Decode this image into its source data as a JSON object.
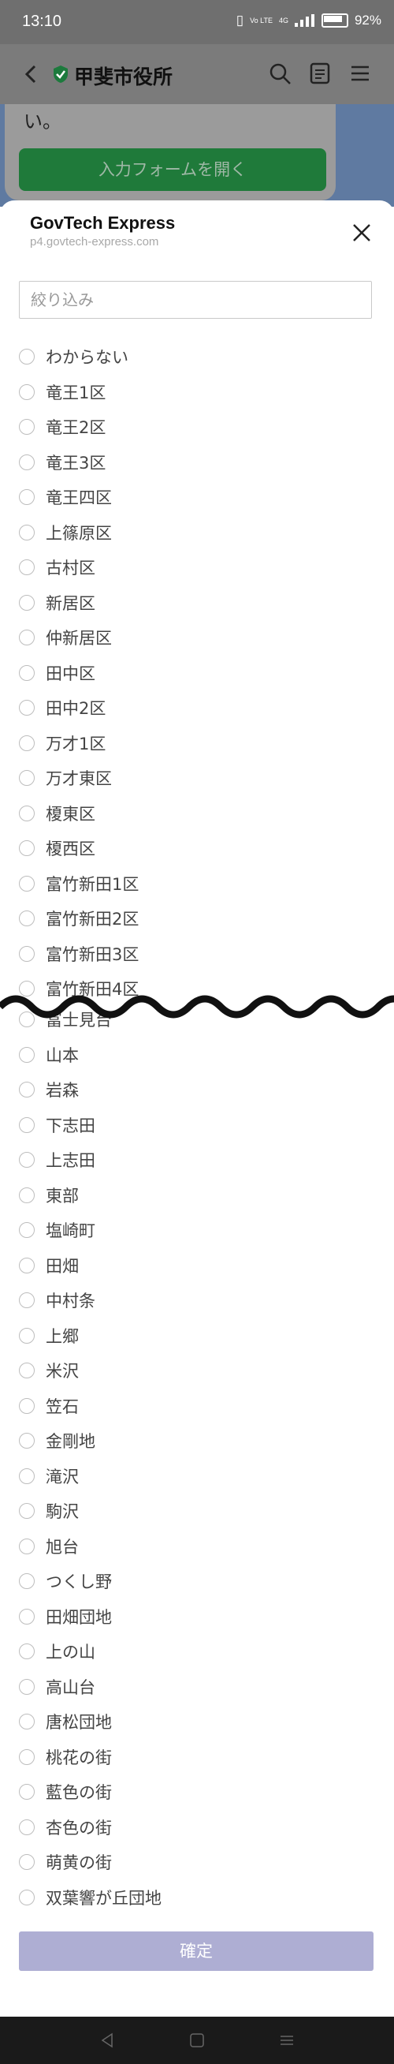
{
  "status": {
    "time": "13:10",
    "battery": "92%",
    "net": "Vo LTE",
    "net2": "4G"
  },
  "appbar": {
    "title": "甲斐市役所"
  },
  "bg": {
    "tail_text": "い。",
    "open_form_label": "入力フォームを開く"
  },
  "sheet": {
    "brand": "GovTech Express",
    "domain": "p4.govtech-express.com",
    "filter_placeholder": "絞り込み",
    "options": [
      "わからない",
      "竜王1区",
      "竜王2区",
      "竜王3区",
      "竜王四区",
      "上篠原区",
      "古村区",
      "新居区",
      "仲新居区",
      "田中区",
      "田中2区",
      "万才1区",
      "万才東区",
      "榎東区",
      "榎西区",
      "富竹新田1区",
      "富竹新田2区",
      "富竹新田3区",
      "富竹新田4区",
      "冨士見台",
      "山本",
      "岩森",
      "下志田",
      "上志田",
      "東部",
      "塩崎町",
      "田畑",
      "中村条",
      "上郷",
      "米沢",
      "笠石",
      "金剛地",
      "滝沢",
      "駒沢",
      "旭台",
      "つくし野",
      "田畑団地",
      "上の山",
      "高山台",
      "唐松団地",
      "桃花の街",
      "藍色の街",
      "杏色の街",
      "萌黄の街",
      "双葉響が丘団地"
    ],
    "confirm_label": "確定"
  },
  "colors": {
    "accent_green": "#1f7a3a",
    "confirm_bg": "#aeaed3"
  }
}
